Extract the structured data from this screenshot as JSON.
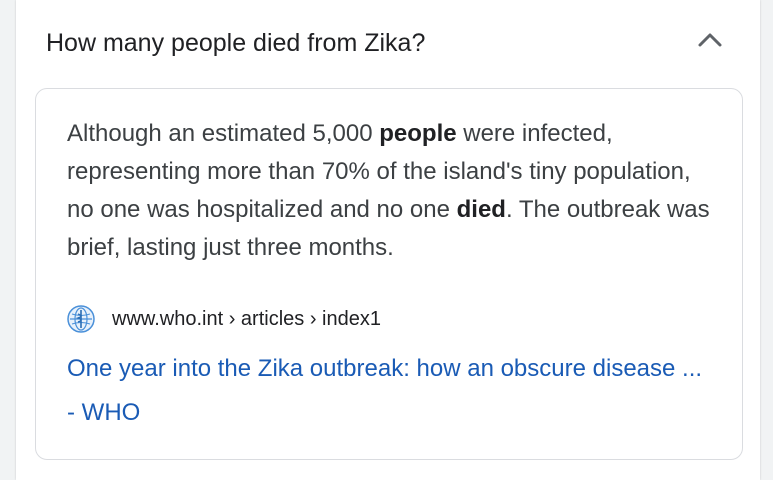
{
  "question": "How many people died from Zika?",
  "icons": {
    "collapse": "chevron-up-icon",
    "favicon": "who-logo-icon"
  },
  "answer": {
    "part1": "Although an estimated 5,000 ",
    "bold1": "people",
    "part2": " were infected, representing more than 70% of the island's tiny population, no one was hospitalized and no one ",
    "bold2": "died",
    "part3": ". The outbreak was brief, lasting just three months."
  },
  "source": {
    "url": "www.who.int › articles › index1"
  },
  "result": {
    "title": "One year into the Zika outbreak: how an obscure disease ... - WHO"
  },
  "colors": {
    "link": "#1a5bb5",
    "text": "#3c4043",
    "border": "#dadce0",
    "favicon": "#4a90d9"
  }
}
